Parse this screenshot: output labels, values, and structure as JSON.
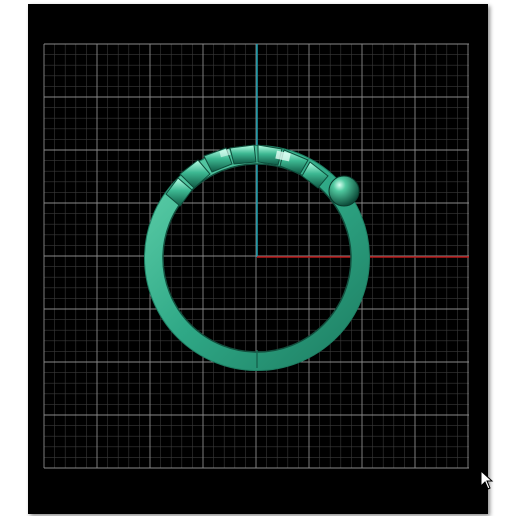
{
  "viewport": {
    "background": "#000000",
    "grid_minor_color": "#3a3a3a",
    "grid_major_color": "#8a8a8a",
    "axis_x_color": "#b81616",
    "axis_y_color": "#1a9fb0"
  },
  "model": {
    "type": "ring",
    "view": "front",
    "band_color": "#2fa886",
    "highlight_color": "#9cf0d2",
    "shadow_color": "#0f5a45",
    "stones": 6
  },
  "cursor": {
    "icon": "arrow-cursor-icon"
  }
}
